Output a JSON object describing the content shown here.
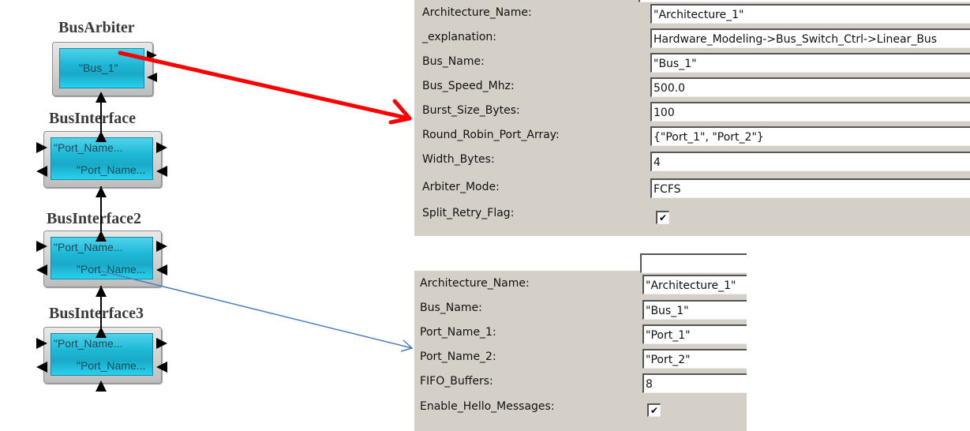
{
  "diagram": {
    "blocks": [
      {
        "title": "BusArbiter",
        "lines": [
          "\"Bus_1\""
        ]
      },
      {
        "title": "BusInterface",
        "lines": [
          "\"Port_Name...",
          "\"Port_Name..."
        ]
      },
      {
        "title": "BusInterface2",
        "lines": [
          "\"Port_Name...",
          "\"Port_Name..."
        ]
      },
      {
        "title": "BusInterface3",
        "lines": [
          "\"Port_Name...",
          "\"Port_Name..."
        ]
      }
    ],
    "arrows": [
      {
        "from": "BusArbiter",
        "to": "bus-arbiter-properties",
        "color": "#ff0000"
      },
      {
        "from": "BusInterface2",
        "to": "bus-interface-properties",
        "color": "#4a7ebb"
      }
    ],
    "connector_color": "#000000",
    "block_fill": "#1db8d6"
  },
  "bus_arbiter_properties": {
    "rows": [
      {
        "label": "Architecture_Name:",
        "value": "\"Architecture_1\""
      },
      {
        "label": "_explanation:",
        "value": "Hardware_Modeling->Bus_Switch_Ctrl->Linear_Bus"
      },
      {
        "label": "Bus_Name:",
        "value": "\"Bus_1\""
      },
      {
        "label": "Bus_Speed_Mhz:",
        "value": "500.0"
      },
      {
        "label": "Burst_Size_Bytes:",
        "value": "100"
      },
      {
        "label": "Round_Robin_Port_Array:",
        "value": "{\"Port_1\", \"Port_2\"}"
      },
      {
        "label": "Width_Bytes:",
        "value": "4"
      },
      {
        "label": "Arbiter_Mode:",
        "value": "FCFS"
      }
    ],
    "checkbox": {
      "label": "Split_Retry_Flag:",
      "checked": true,
      "mark": "✔"
    }
  },
  "bus_interface_properties": {
    "rows": [
      {
        "label": "Architecture_Name:",
        "value": "\"Architecture_1\""
      },
      {
        "label": "Bus_Name:",
        "value": "\"Bus_1\""
      },
      {
        "label": "Port_Name_1:",
        "value": "\"Port_1\""
      },
      {
        "label": "Port_Name_2:",
        "value": "\"Port_2\""
      },
      {
        "label": "FIFO_Buffers:",
        "value": "8"
      }
    ],
    "checkbox": {
      "label": "Enable_Hello_Messages:",
      "checked": true,
      "mark": "✔"
    }
  }
}
